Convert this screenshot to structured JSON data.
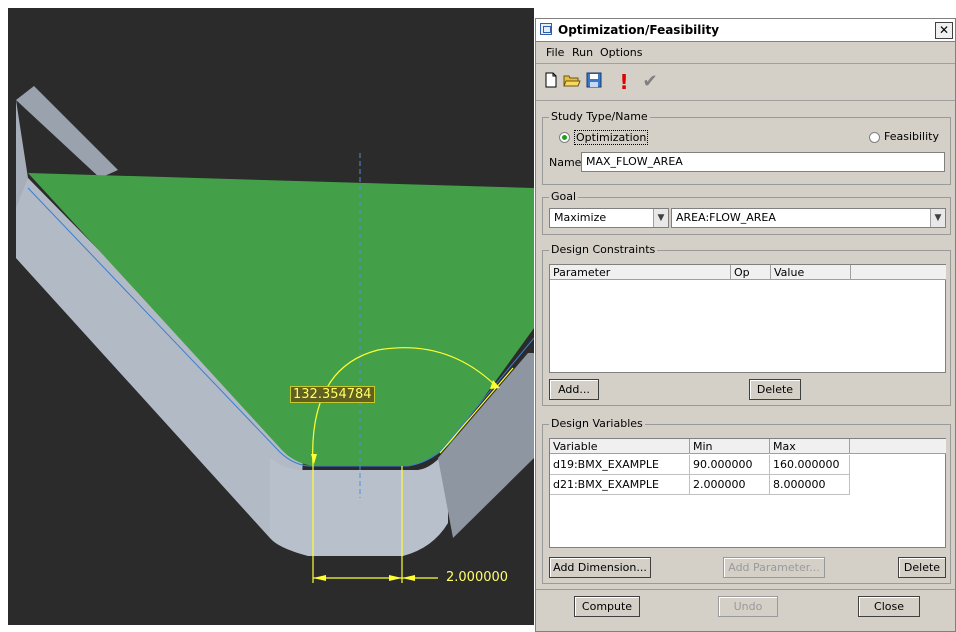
{
  "viewport": {
    "angle_dimension": "132.354784",
    "length_dimension": "2.000000",
    "colors": {
      "background": "#2b2b2b",
      "surface": "#44a048",
      "wall": "#a8b0bc",
      "dimension": "#ffff33"
    }
  },
  "dialog": {
    "title": "Optimization/Feasibility",
    "close_label": "✕",
    "menu": {
      "file": "File",
      "run": "Run",
      "options": "Options"
    },
    "toolbar": [
      "new-file-icon",
      "open-folder-icon",
      "save-icon",
      "run-icon",
      "accept-check-icon"
    ],
    "study": {
      "group_title": "Study Type/Name",
      "optimization_label": "Optimization",
      "feasibility_label": "Feasibility",
      "selected": "Optimization",
      "name_label": "Name",
      "name_value": "MAX_FLOW_AREA"
    },
    "goal": {
      "group_title": "Goal",
      "type": "Maximize",
      "measure": "AREA:FLOW_AREA"
    },
    "constraints": {
      "group_title": "Design Constraints",
      "columns": [
        "Parameter",
        "Op",
        "Value"
      ],
      "rows": [],
      "add_label": "Add...",
      "delete_label": "Delete"
    },
    "variables": {
      "group_title": "Design Variables",
      "columns": [
        "Variable",
        "Min",
        "Max"
      ],
      "rows": [
        {
          "variable": "d19:BMX_EXAMPLE",
          "min": "90.000000",
          "max": "160.000000"
        },
        {
          "variable": "d21:BMX_EXAMPLE",
          "min": "2.000000",
          "max": "8.000000"
        }
      ],
      "add_dimension_label": "Add Dimension...",
      "add_parameter_label": "Add Parameter...",
      "delete_label": "Delete"
    },
    "footer": {
      "compute_label": "Compute",
      "undo_label": "Undo",
      "close_label": "Close"
    }
  }
}
